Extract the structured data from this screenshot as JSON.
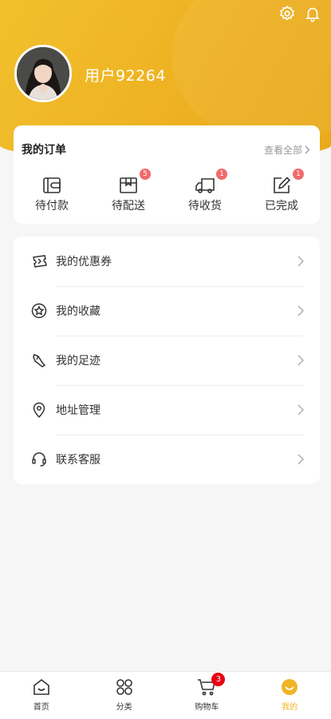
{
  "header": {
    "username": "用户92264",
    "icons": [
      "settings-icon",
      "bell-icon"
    ],
    "gradient_colors": [
      "#f2c02c",
      "#e9a91a"
    ]
  },
  "orders": {
    "title": "我的订单",
    "view_all": "查看全部",
    "items": [
      {
        "label": "待付款",
        "icon": "wallet-icon",
        "badge": ""
      },
      {
        "label": "待配送",
        "icon": "package-icon",
        "badge": "5"
      },
      {
        "label": "待收货",
        "icon": "truck-icon",
        "badge": "1"
      },
      {
        "label": "已完成",
        "icon": "edit-icon",
        "badge": "1"
      }
    ]
  },
  "menu": {
    "items": [
      {
        "label": "我的优惠券",
        "icon": "coupon-icon"
      },
      {
        "label": "我的收藏",
        "icon": "star-icon"
      },
      {
        "label": "我的足迹",
        "icon": "footprint-icon"
      },
      {
        "label": "地址管理",
        "icon": "location-icon"
      },
      {
        "label": "联系客服",
        "icon": "headset-icon"
      }
    ]
  },
  "tabbar": {
    "items": [
      {
        "label": "首页",
        "icon": "home-icon"
      },
      {
        "label": "分类",
        "icon": "category-icon"
      },
      {
        "label": "购物车",
        "icon": "cart-icon",
        "badge": "3"
      },
      {
        "label": "我的",
        "icon": "smile-icon",
        "active": true
      }
    ],
    "active_color": "#f0b323"
  }
}
